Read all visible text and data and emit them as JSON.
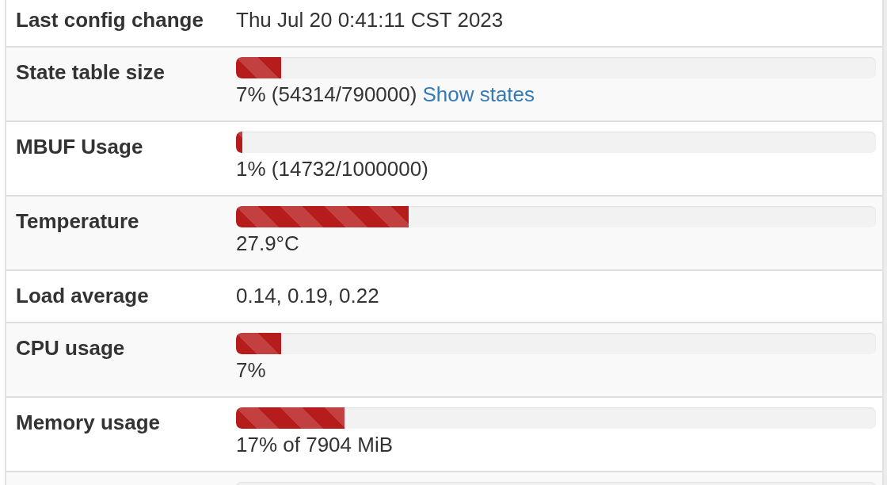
{
  "rows": [
    {
      "kind": "text",
      "label": "Last config change",
      "value": "Thu Jul 20 0:41:11 CST 2023"
    },
    {
      "kind": "progress",
      "label": "State table size",
      "level": 0.07,
      "value": "7% (54314/790000)",
      "link": "Show states"
    },
    {
      "kind": "progress",
      "label": "MBUF Usage",
      "level": 0.01,
      "value": "1% (14732/1000000)"
    },
    {
      "kind": "progress",
      "label": "Temperature",
      "level": 0.27,
      "value": "27.9°C"
    },
    {
      "kind": "text",
      "label": "Load average",
      "value": "0.14, 0.19, 0.22"
    },
    {
      "kind": "progress",
      "label": "CPU usage",
      "level": 0.07,
      "value": "7%"
    },
    {
      "kind": "progress",
      "label": "Memory usage",
      "level": 0.17,
      "value": "17% of 7904 MiB"
    },
    {
      "kind": "progress"
    }
  ]
}
